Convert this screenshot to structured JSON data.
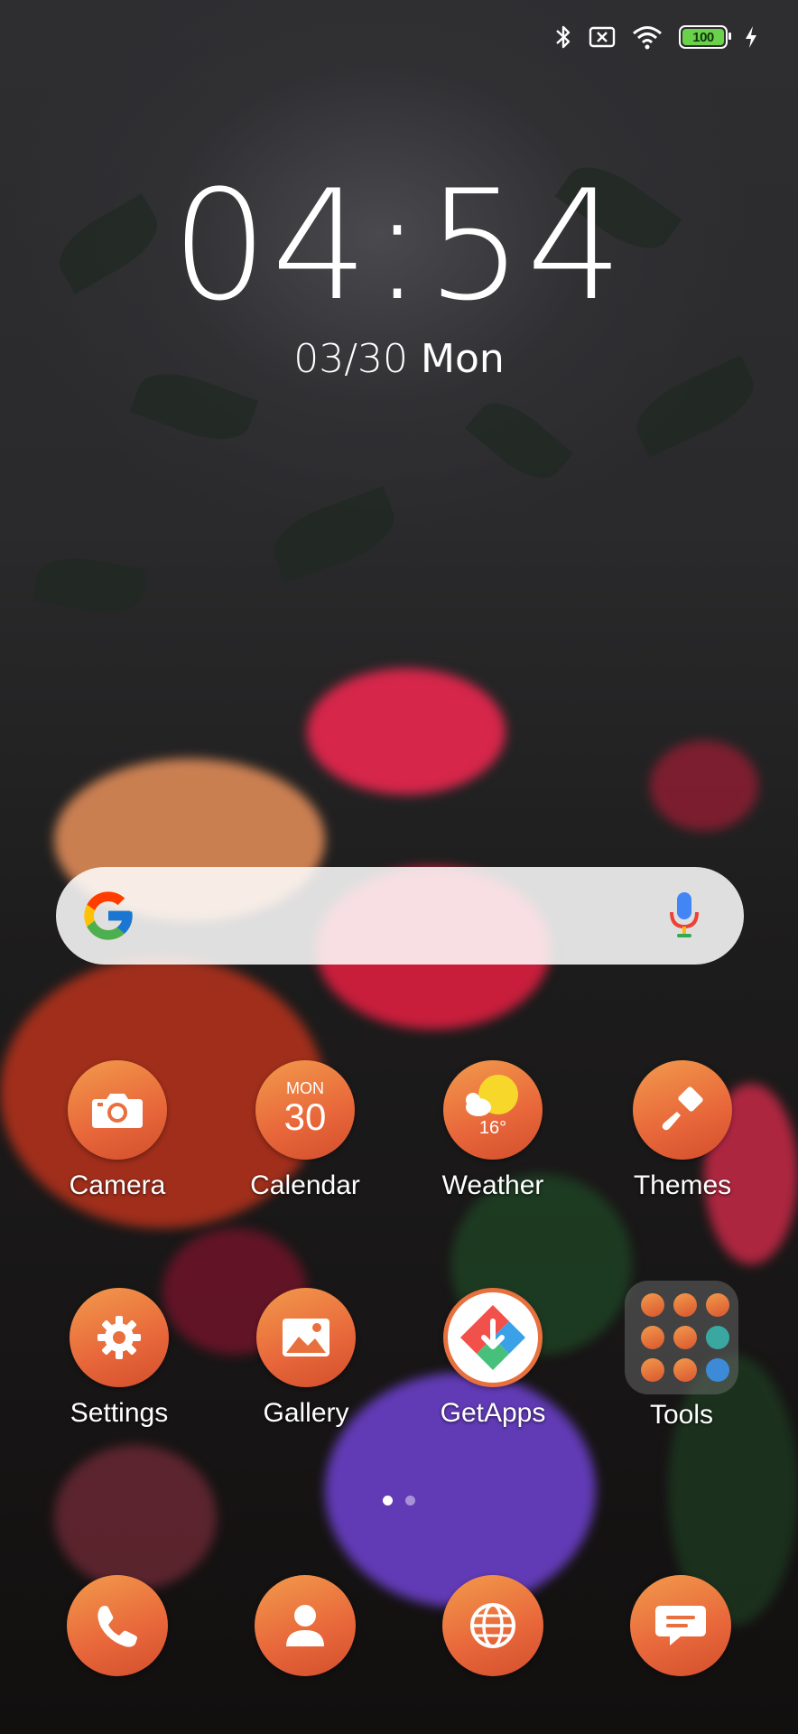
{
  "status_bar": {
    "battery_level": "100",
    "icons": [
      "bluetooth-icon",
      "no-sim-icon",
      "wifi-icon",
      "battery-icon",
      "charging-icon"
    ]
  },
  "clock": {
    "time": "04:54",
    "date": "03/30",
    "weekday": "Mon"
  },
  "search": {
    "icons": [
      "google-logo-icon",
      "microphone-icon"
    ]
  },
  "apps": [
    {
      "label": "Camera",
      "icon": "camera-icon"
    },
    {
      "label": "Calendar",
      "icon": "calendar-icon",
      "month": "MON",
      "day": "30"
    },
    {
      "label": "Weather",
      "icon": "weather-icon",
      "temp": "16°"
    },
    {
      "label": "Themes",
      "icon": "paintbrush-icon"
    },
    {
      "label": "Settings",
      "icon": "gear-icon"
    },
    {
      "label": "Gallery",
      "icon": "image-icon"
    },
    {
      "label": "GetApps",
      "icon": "getapps-icon"
    },
    {
      "label": "Tools",
      "icon": "folder-icon"
    }
  ],
  "dock": [
    {
      "icon": "phone-icon"
    },
    {
      "icon": "contacts-icon"
    },
    {
      "icon": "browser-globe-icon"
    },
    {
      "icon": "messages-icon"
    }
  ],
  "page_indicator": {
    "pages": 2,
    "current": 1
  },
  "colors": {
    "icon_gradient_start": "#f29a4c",
    "icon_gradient_end": "#d24f2c",
    "battery_fill": "#6ad24a"
  }
}
